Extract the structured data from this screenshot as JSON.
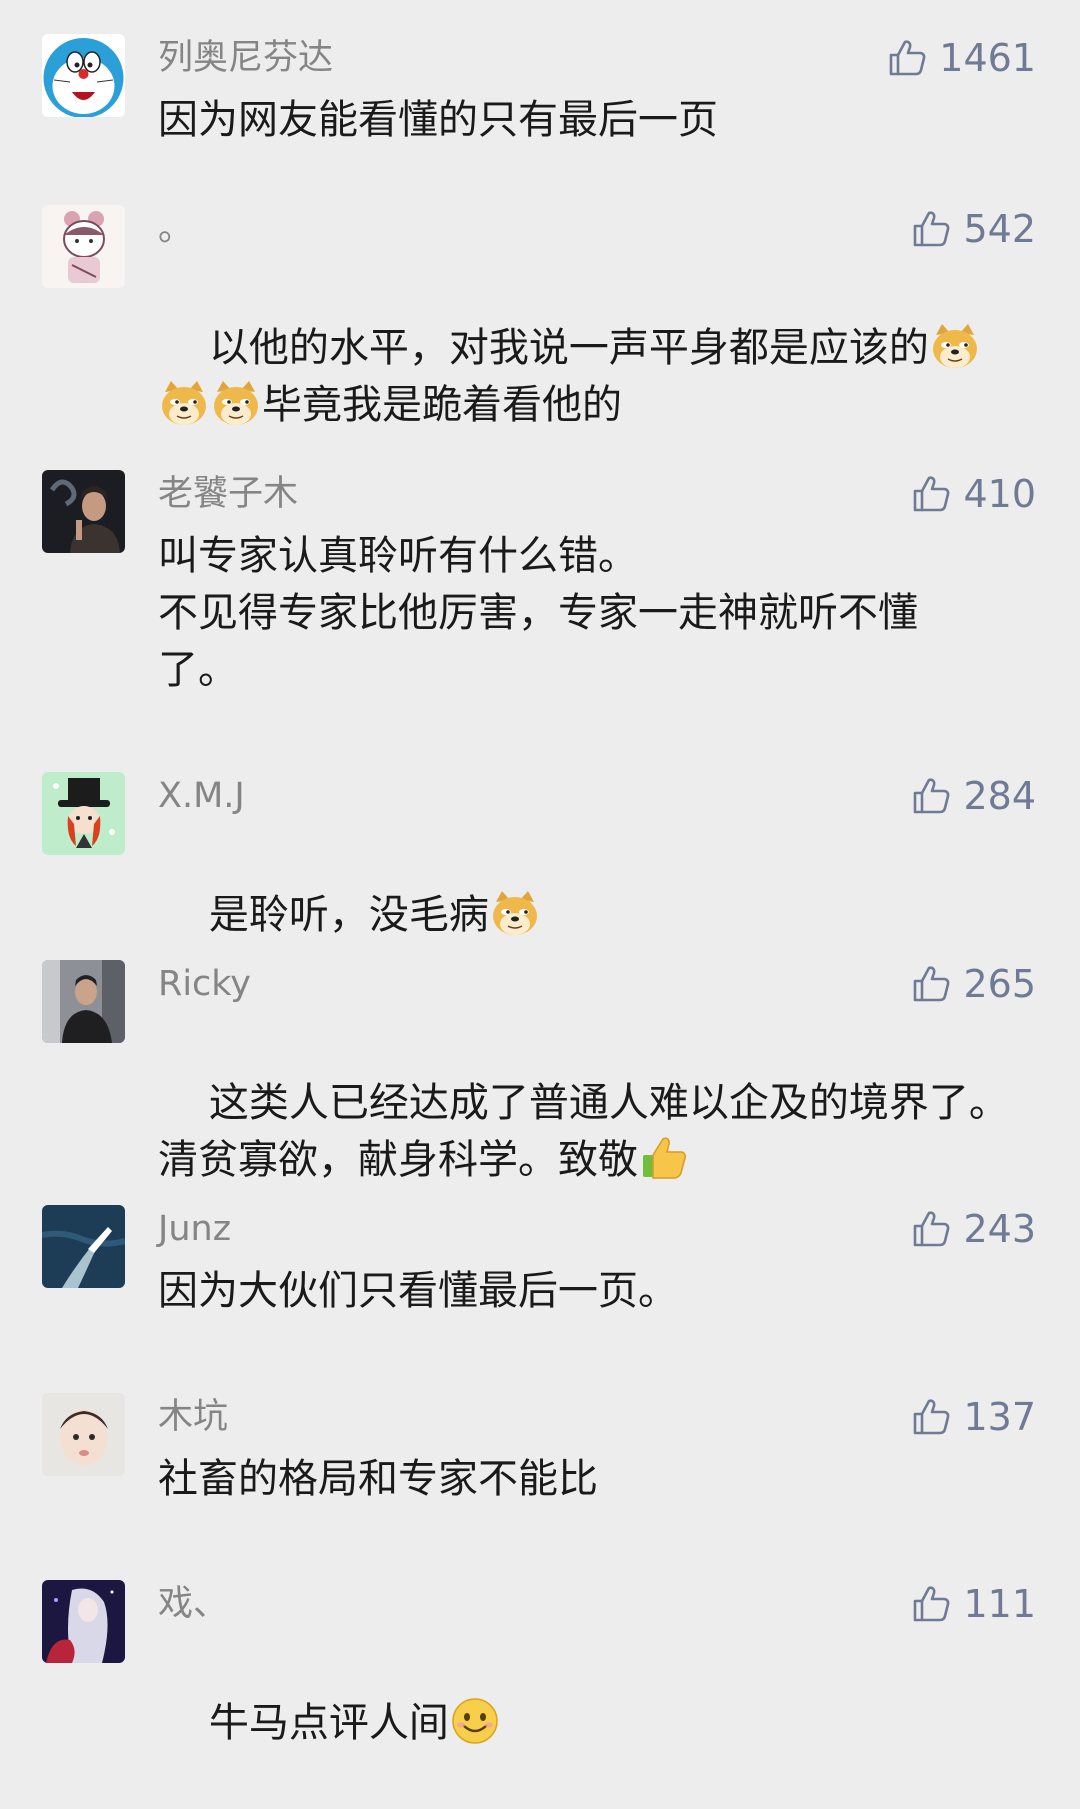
{
  "comments": [
    {
      "user": "列奥尼芬达",
      "likes": "1461",
      "text": "因为网友能看懂的只有最后一页",
      "avatar_icon": "doraemon-avatar"
    },
    {
      "user": "。",
      "likes": "542",
      "text_a": "以他的水平，对我说一声平身都是应该的",
      "text_b": "毕竟我是跪着看他的",
      "avatar_icon": "cartoon-girl-avatar",
      "emoji": "doge-emoji"
    },
    {
      "user": "老饕子木",
      "likes": "410",
      "text": "叫专家认真聆听有什么错。\n不见得专家比他厉害，专家一走神就听不懂\n了。",
      "avatar_icon": "smoking-man-avatar"
    },
    {
      "user": "X.M.J",
      "likes": "284",
      "text": "是聆听，没毛病",
      "avatar_icon": "top-hat-avatar",
      "emoji": "doge-emoji"
    },
    {
      "user": "Ricky",
      "likes": "265",
      "text_a": "这类人已经达成了普通人难以企及的境界了。",
      "text_b": "清贫寡欲，献身科学。致敬",
      "avatar_icon": "man-photo-avatar",
      "emoji": "thumbs-up-emoji"
    },
    {
      "user": "Junz",
      "likes": "243",
      "text": "因为大伙们只看懂最后一页。",
      "avatar_icon": "boat-avatar"
    },
    {
      "user": "木坑",
      "likes": "137",
      "text": "社畜的格局和专家不能比",
      "avatar_icon": "baby-avatar"
    },
    {
      "user": "戏、",
      "likes": "111",
      "text": "牛马点评人间",
      "avatar_icon": "anime-girl-avatar",
      "emoji": "smile-emoji"
    }
  ],
  "colors": {
    "background": "#ededed",
    "username": "#858585",
    "like": "#6f7a94",
    "text": "#1a1a1a"
  }
}
